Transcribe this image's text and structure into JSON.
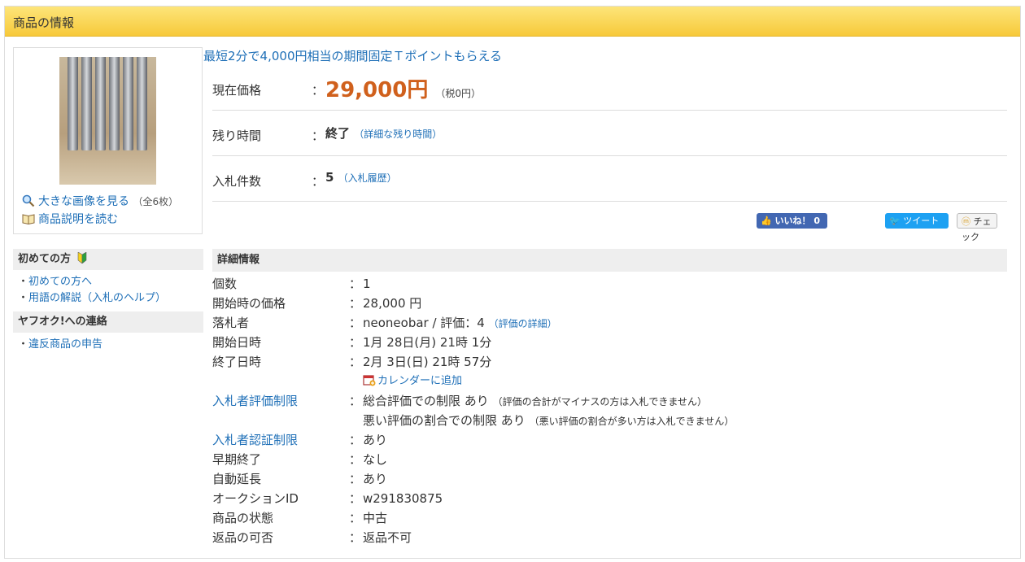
{
  "panel_title": "商品の情報",
  "image_links": {
    "enlarge": "大きな画像を見る",
    "count": "（全6枚）",
    "description": "商品説明を読む"
  },
  "promo": "最短2分で4,000円相当の期間固定Ｔポイントもらえる",
  "current_price": {
    "label": "現在価格",
    "colon": "：",
    "value": "29,000円",
    "tax": "（税0円）"
  },
  "time_left": {
    "label": "残り時間",
    "colon": "：",
    "value": "終了",
    "link": "（詳細な残り時間）"
  },
  "bids": {
    "label": "入札件数",
    "colon": "：",
    "value": "5",
    "link": "（入札履歴）"
  },
  "social": {
    "like": "いいね！ 0",
    "tweet": "ツイート",
    "check": "チェック"
  },
  "sidebar": {
    "section1": {
      "title": "初めての方",
      "items": [
        "初めての方へ",
        "用語の解説（入札のヘルプ）"
      ]
    },
    "section2": {
      "title": "ヤフオク!への連絡",
      "items": [
        "違反商品の申告"
      ]
    }
  },
  "details": {
    "title": "詳細情報",
    "colon": "：",
    "rows": {
      "quantity": {
        "label": "個数",
        "value": "1"
      },
      "start_price": {
        "label": "開始時の価格",
        "value": "28,000 円"
      },
      "winner": {
        "label": "落札者",
        "value": "neoneobar / 評価：4",
        "link": "（評価の詳細）"
      },
      "start_date": {
        "label": "開始日時",
        "value": "1月 28日(月) 21時 1分"
      },
      "end_date": {
        "label": "終了日時",
        "value": "2月 3日(日) 21時 57分",
        "calendar": "カレンダーに追加"
      },
      "rating_limit": {
        "label": "入札者評価制限",
        "value1": "総合評価での制限 あり",
        "note1": "（評価の合計がマイナスの方は入札できません）",
        "value2": "悪い評価の割合での制限 あり",
        "note2": "（悪い評価の割合が多い方は入札できません）"
      },
      "auth_limit": {
        "label": "入札者認証制限",
        "value": "あり"
      },
      "early_end": {
        "label": "早期終了",
        "value": "なし"
      },
      "auto_extend": {
        "label": "自動延長",
        "value": "あり"
      },
      "auction_id": {
        "label": "オークションID",
        "value": "w291830875"
      },
      "condition": {
        "label": "商品の状態",
        "value": "中古"
      },
      "returns": {
        "label": "返品の可否",
        "value": "返品不可"
      }
    }
  }
}
